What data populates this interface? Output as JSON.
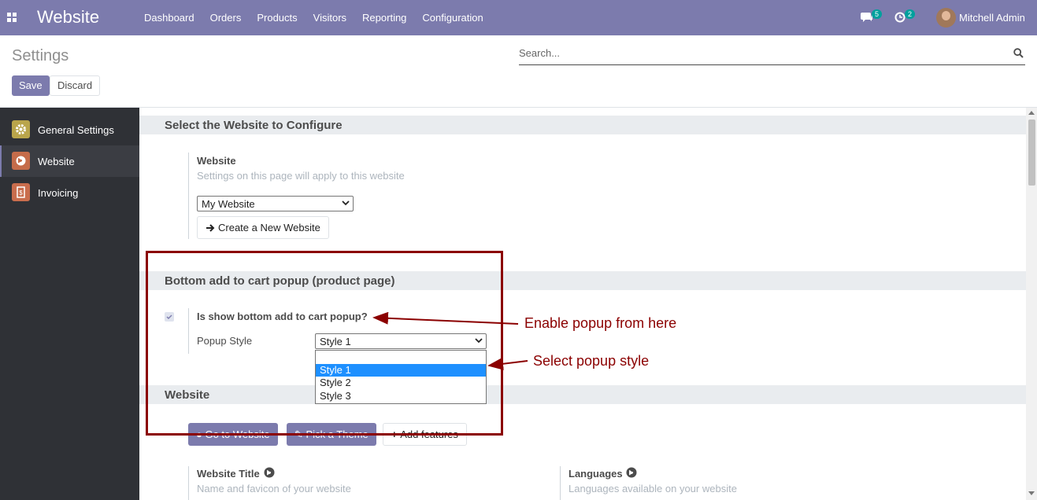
{
  "navbar": {
    "brand": "Website",
    "menu": [
      "Dashboard",
      "Orders",
      "Products",
      "Visitors",
      "Reporting",
      "Configuration"
    ],
    "messages_count": "5",
    "activities_count": "2",
    "user": "Mitchell Admin"
  },
  "control_panel": {
    "title": "Settings",
    "save_label": "Save",
    "discard_label": "Discard",
    "search_placeholder": "Search..."
  },
  "sidebar": {
    "items": [
      {
        "label": "General Settings",
        "color": "#b9a54b"
      },
      {
        "label": "Website",
        "color": "#c56c4a"
      },
      {
        "label": "Invoicing",
        "color": "#c96d4d"
      }
    ]
  },
  "section1": {
    "title": "Select the Website to Configure",
    "field_label": "Website",
    "field_help": "Settings on this page will apply to this website",
    "select_value": "My Website",
    "create_button": "Create a New Website"
  },
  "section2": {
    "title": "Bottom add to cart popup (product page)",
    "checkbox_label": "Is show bottom add to cart popup?",
    "popup_style_label": "Popup Style",
    "popup_style_value": "Style 1",
    "options": [
      "",
      "Style 1",
      "Style 2",
      "Style 3"
    ]
  },
  "section3": {
    "title": "Website",
    "buttons": [
      "Go to Website",
      "Pick a Theme",
      "Add features"
    ],
    "website_title_label": "Website Title",
    "website_title_help": "Name and favicon of your website",
    "languages_label": "Languages",
    "languages_help": "Languages available on your website"
  },
  "annotations": {
    "enable": "Enable popup from here",
    "select": "Select popup style",
    "color": "#8b0000"
  }
}
